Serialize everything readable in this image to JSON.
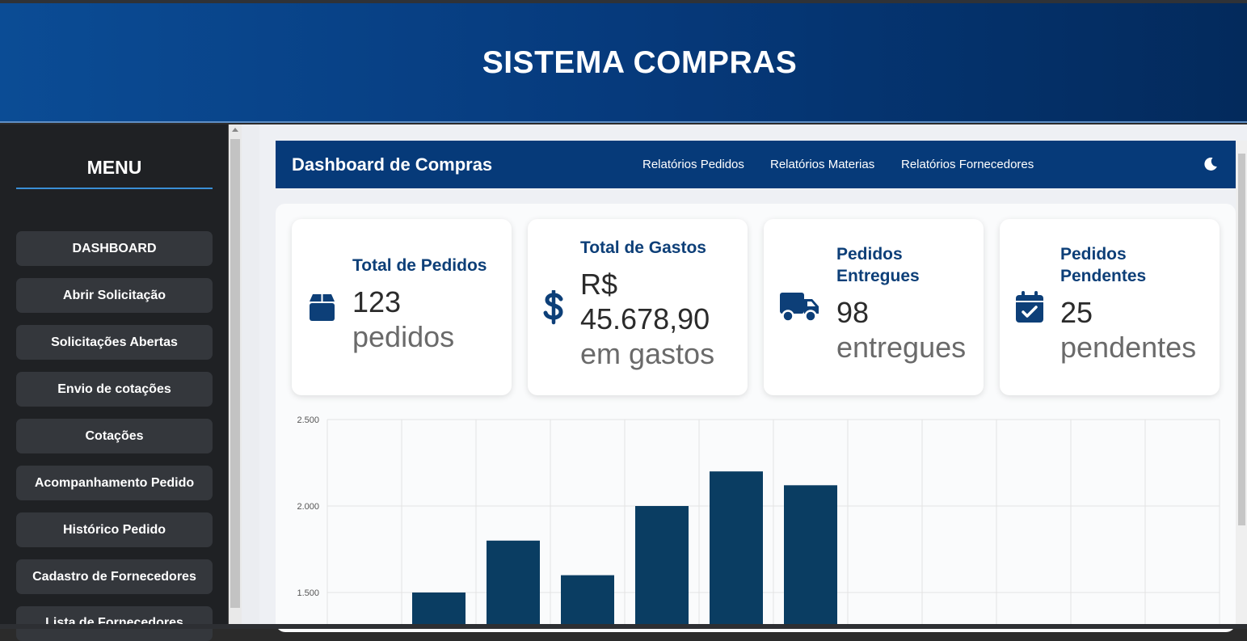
{
  "header": {
    "title": "SISTEMA COMPRAS"
  },
  "sidebar": {
    "title": "MENU",
    "items": [
      {
        "label": "DASHBOARD"
      },
      {
        "label": "Abrir Solicitação"
      },
      {
        "label": "Solicitações Abertas"
      },
      {
        "label": "Envio de cotações"
      },
      {
        "label": "Cotações"
      },
      {
        "label": "Acompanhamento Pedido"
      },
      {
        "label": "Histórico Pedido"
      },
      {
        "label": "Cadastro de Fornecedores"
      },
      {
        "label": "Lista de Fornecedores"
      }
    ]
  },
  "navbar": {
    "brand": "Dashboard de Compras",
    "links": [
      {
        "label": "Relatórios Pedidos"
      },
      {
        "label": "Relatórios Materias"
      },
      {
        "label": "Relatórios Fornecedores"
      }
    ],
    "theme_icon": "moon-icon"
  },
  "cards": [
    {
      "title": "Total de Pedidos",
      "value": "123",
      "unit": "pedidos",
      "icon": "box-icon"
    },
    {
      "title": "Total de Gastos",
      "value": "R$ 45.678,90",
      "unit": "em gastos",
      "icon": "dollar-icon"
    },
    {
      "title": "Pedidos Entregues",
      "value": "98",
      "unit": "entregues",
      "icon": "truck-icon"
    },
    {
      "title": "Pedidos Pendentes",
      "value": "25",
      "unit": "pendentes",
      "icon": "calendar-check-icon"
    }
  ],
  "colors": {
    "primary": "#063a79",
    "bar": "#0a3d62",
    "card_title": "#0d3f78"
  },
  "chart_data": {
    "type": "bar",
    "y_ticks": [
      "2.500",
      "2.000",
      "1.500"
    ],
    "ylim_visible": [
      1300,
      2500
    ],
    "grid": true,
    "categories_count": 12,
    "values": [
      null,
      1500,
      1800,
      1600,
      2000,
      2200,
      2120,
      null,
      null,
      null,
      null,
      null
    ],
    "color": "#0a3d62"
  }
}
